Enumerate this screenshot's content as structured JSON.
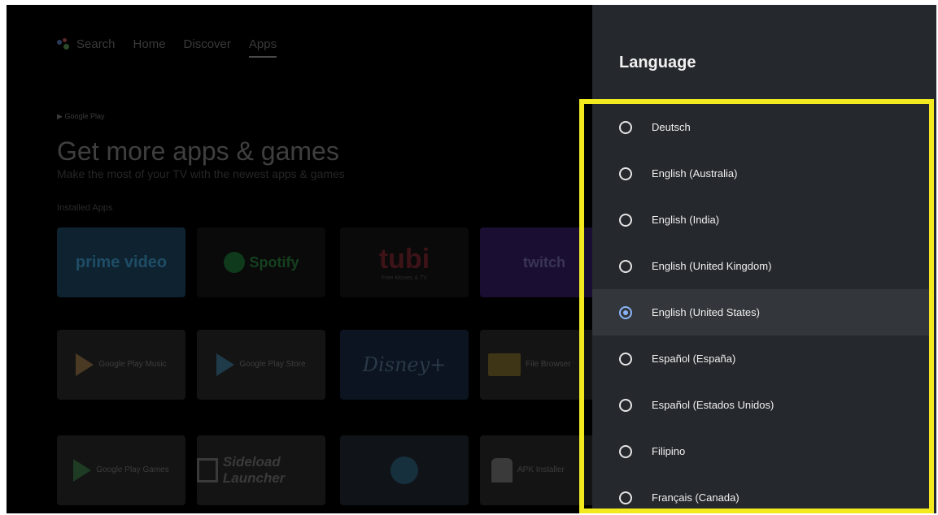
{
  "nav": {
    "items": [
      {
        "label": "Search"
      },
      {
        "label": "Home"
      },
      {
        "label": "Discover"
      },
      {
        "label": "Apps"
      }
    ]
  },
  "launcher": {
    "store_label": "Google Play",
    "hero_title": "Get more apps & games",
    "hero_subtitle": "Make the most of your TV with the newest apps & games",
    "row_label": "Installed Apps",
    "tiles_row1": [
      "prime video",
      "Spotify",
      "tubi",
      "twitch"
    ],
    "tiles_row2": [
      "Google Play Music",
      "Google Play Store",
      "Disney+",
      "File Browser"
    ],
    "tiles_row3": [
      "Google Play Games",
      "Sideload Launcher",
      "",
      "APK Installer"
    ],
    "tubi_tagline": "Free Movies & TV"
  },
  "panel": {
    "title": "Language",
    "options": [
      {
        "label": "Deutsch",
        "selected": false
      },
      {
        "label": "English (Australia)",
        "selected": false
      },
      {
        "label": "English (India)",
        "selected": false
      },
      {
        "label": "English (United Kingdom)",
        "selected": false
      },
      {
        "label": "English (United States)",
        "selected": true
      },
      {
        "label": "Español (España)",
        "selected": false
      },
      {
        "label": "Español (Estados Unidos)",
        "selected": false
      },
      {
        "label": "Filipino",
        "selected": false
      },
      {
        "label": "Français (Canada)",
        "selected": false
      }
    ]
  },
  "colors": {
    "highlight": "#f2ea1f",
    "selected_radio": "#8ab4f8",
    "panel_bg": "#25282c"
  }
}
